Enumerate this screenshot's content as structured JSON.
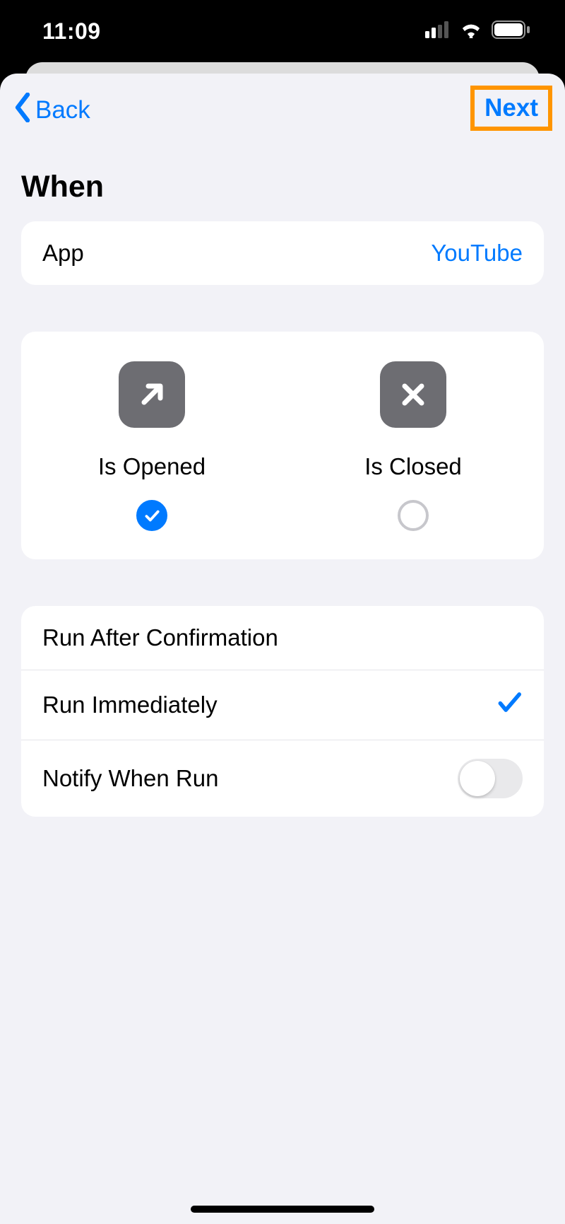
{
  "status": {
    "time": "11:09"
  },
  "nav": {
    "back": "Back",
    "next": "Next"
  },
  "page": {
    "title": "When"
  },
  "app_row": {
    "label": "App",
    "value": "YouTube"
  },
  "triggers": {
    "opened": {
      "label": "Is Opened",
      "selected": true
    },
    "closed": {
      "label": "Is Closed",
      "selected": false
    }
  },
  "options": {
    "run_after_confirmation": {
      "label": "Run After Confirmation",
      "selected": false
    },
    "run_immediately": {
      "label": "Run Immediately",
      "selected": true
    },
    "notify_when_run": {
      "label": "Notify When Run",
      "enabled": false
    }
  },
  "highlight": {
    "target": "next-button"
  }
}
